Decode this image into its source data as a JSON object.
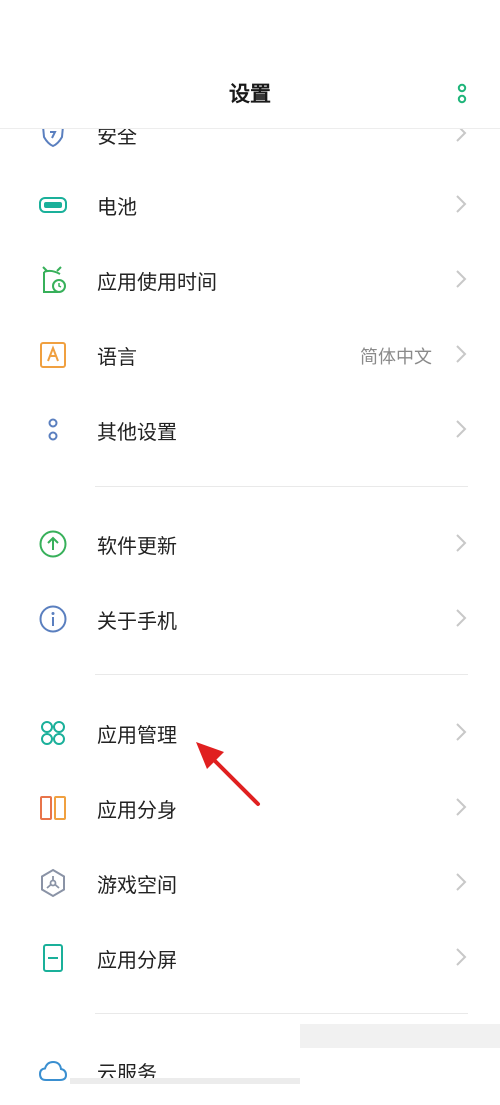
{
  "header": {
    "title": "设置"
  },
  "rows": [
    {
      "label": "安全",
      "icon": "shield-icon"
    },
    {
      "label": "电池",
      "icon": "battery-icon"
    },
    {
      "label": "应用使用时间",
      "icon": "app-usage-time-icon"
    },
    {
      "label": "语言",
      "value": "简体中文",
      "icon": "language-icon"
    },
    {
      "label": "其他设置",
      "icon": "other-settings-icon"
    },
    {
      "label": "软件更新",
      "icon": "software-update-icon"
    },
    {
      "label": "关于手机",
      "icon": "info-icon"
    },
    {
      "label": "应用管理",
      "icon": "app-management-icon"
    },
    {
      "label": "应用分身",
      "icon": "app-clone-icon"
    },
    {
      "label": "游戏空间",
      "icon": "game-space-icon"
    },
    {
      "label": "应用分屏",
      "icon": "split-screen-icon"
    },
    {
      "label": "云服务",
      "icon": "cloud-icon"
    }
  ],
  "colors": {
    "accent": "#1fb57a",
    "icon_blue": "#5a7fbf",
    "icon_teal": "#1ab09a",
    "icon_green": "#37b05a",
    "icon_orange": "#f0a040",
    "annotation_arrow": "#e02020"
  }
}
